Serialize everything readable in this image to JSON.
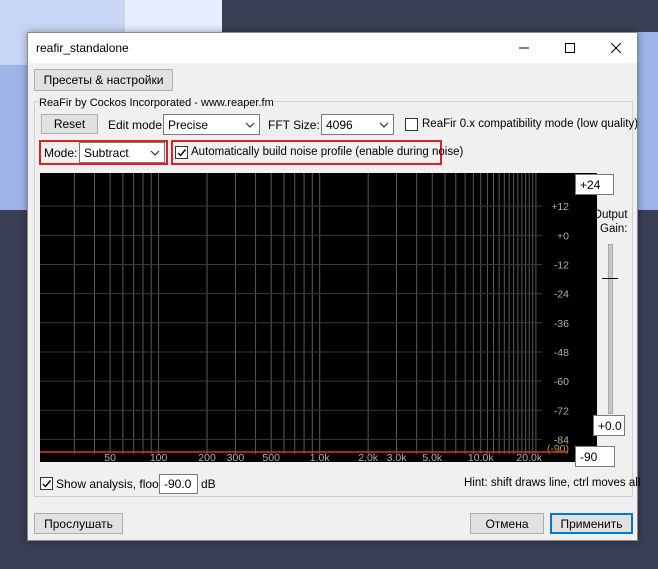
{
  "window": {
    "title": "reafir_standalone",
    "minimize_icon": "minimize-icon",
    "maximize_icon": "maximize-icon",
    "close_icon": "close-icon"
  },
  "top": {
    "presets_label": "Пресеты & настройки"
  },
  "plugin": {
    "caption": "ReaFir by Cockos Incorporated - www.reaper.fm",
    "reset_label": "Reset",
    "edit_mode_label": "Edit mode:",
    "edit_mode_value": "Precise",
    "fft_label": "FFT Size:",
    "fft_value": "4096",
    "compat_label": "ReaFir 0.x compatibility mode (low quality)",
    "compat_checked": false,
    "mode_label": "Mode:",
    "mode_value": "Subtract",
    "autobuild_label": "Automatically build noise profile (enable during noise)",
    "autobuild_checked": true
  },
  "graph": {
    "db_labels": [
      "+12",
      "+0",
      "-12",
      "-24",
      "-36",
      "-48",
      "-60",
      "-72",
      "-84"
    ],
    "floor_label": "(-90)",
    "freq_labels": [
      "50",
      "100",
      "200",
      "300",
      "500",
      "1.0k",
      "2.0k",
      "3.0k",
      "5.0k",
      "10.0k",
      "20.0k"
    ],
    "line_color": "#e03020",
    "grid_color": "#5a5a5a"
  },
  "gain": {
    "top_value": "+24",
    "title_line1": "Output",
    "title_line2": "Gain:",
    "current_value": "+0.0",
    "bottom_value": "-90"
  },
  "analysis": {
    "show_label": "Show analysis, floor:",
    "show_checked": true,
    "floor_value": "-90.0",
    "unit": "dB",
    "hint": "Hint: shift draws line, ctrl moves all"
  },
  "footer": {
    "listen_label": "Прослушать",
    "cancel_label": "Отмена",
    "apply_label": "Применить"
  }
}
